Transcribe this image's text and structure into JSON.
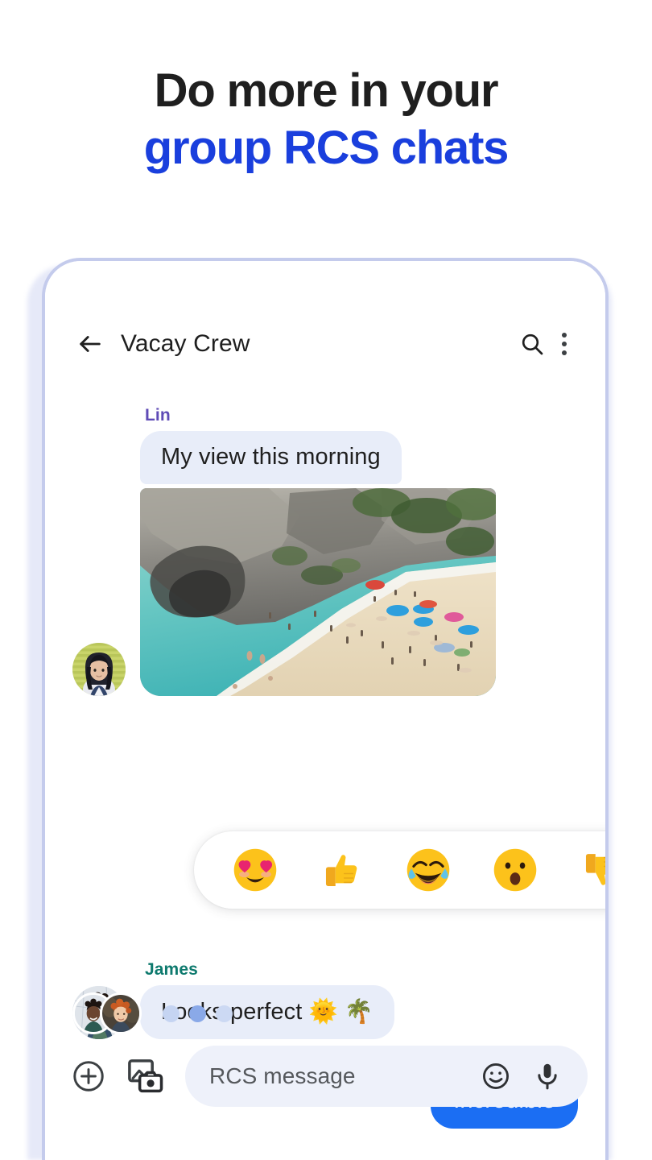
{
  "headline": {
    "line1": "Do more in your",
    "line2": "group RCS chats",
    "color_dark": "#1f1f1f",
    "color_accent": "#1a3fdd"
  },
  "phone": {
    "frame_color": "#c4cbec"
  },
  "appbar": {
    "back_icon": "arrow-left-icon",
    "title": "Vacay Crew",
    "search_icon": "search-icon",
    "menu_icon": "more-vert-icon"
  },
  "thread": {
    "messages": [
      {
        "sender": "Lin",
        "sender_color": "#5f4bb6",
        "text": "My view this morning",
        "attachment": "beach-photo",
        "side": "in"
      },
      {
        "sender": "James",
        "sender_color": "#0e7a6e",
        "text": "Looks perfect 🌞 🌴",
        "side": "in"
      },
      {
        "sender": "",
        "text": "Incredible",
        "side": "out"
      }
    ],
    "reactions": [
      {
        "name": "heart-eyes-emoji",
        "glyph": "😍"
      },
      {
        "name": "thumbs-up-emoji",
        "glyph": "👍"
      },
      {
        "name": "joy-emoji",
        "glyph": "😂"
      },
      {
        "name": "surprised-emoji",
        "glyph": "😮"
      },
      {
        "name": "thumbs-down-emoji",
        "glyph": "👎"
      }
    ],
    "typing": {
      "dots": 3,
      "avatar_count": 2
    },
    "bubble_in_color": "#e8edf9",
    "bubble_out_color": "#1b6ef3"
  },
  "compose": {
    "plus_icon": "plus-circle-icon",
    "gallery_icon": "gallery-camera-icon",
    "placeholder": "RCS message",
    "emoji_icon": "emoji-smile-icon",
    "mic_icon": "microphone-icon",
    "field_color": "#eef1fa"
  }
}
